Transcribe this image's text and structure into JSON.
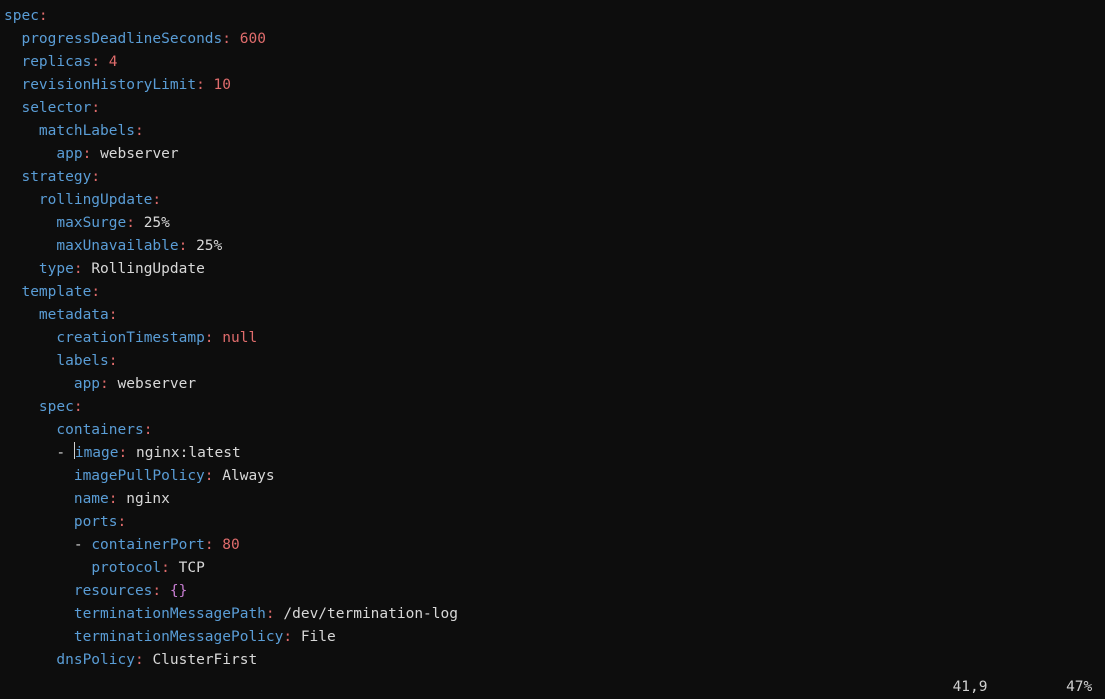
{
  "lines": [
    {
      "indent": 0,
      "key": "spec",
      "val": "",
      "type": "none"
    },
    {
      "indent": 1,
      "key": "progressDeadlineSeconds",
      "val": "600",
      "type": "num"
    },
    {
      "indent": 1,
      "key": "replicas",
      "val": "4",
      "type": "num"
    },
    {
      "indent": 1,
      "key": "revisionHistoryLimit",
      "val": "10",
      "type": "num"
    },
    {
      "indent": 1,
      "key": "selector",
      "val": "",
      "type": "none"
    },
    {
      "indent": 2,
      "key": "matchLabels",
      "val": "",
      "type": "none"
    },
    {
      "indent": 3,
      "key": "app",
      "val": "webserver",
      "type": "str"
    },
    {
      "indent": 1,
      "key": "strategy",
      "val": "",
      "type": "none"
    },
    {
      "indent": 2,
      "key": "rollingUpdate",
      "val": "",
      "type": "none"
    },
    {
      "indent": 3,
      "key": "maxSurge",
      "val": "25%",
      "type": "str"
    },
    {
      "indent": 3,
      "key": "maxUnavailable",
      "val": "25%",
      "type": "str"
    },
    {
      "indent": 2,
      "key": "type",
      "val": "RollingUpdate",
      "type": "str"
    },
    {
      "indent": 1,
      "key": "template",
      "val": "",
      "type": "none"
    },
    {
      "indent": 2,
      "key": "metadata",
      "val": "",
      "type": "none"
    },
    {
      "indent": 3,
      "key": "creationTimestamp",
      "val": "null",
      "type": "bool"
    },
    {
      "indent": 3,
      "key": "labels",
      "val": "",
      "type": "none"
    },
    {
      "indent": 4,
      "key": "app",
      "val": "webserver",
      "type": "str"
    },
    {
      "indent": 2,
      "key": "spec",
      "val": "",
      "type": "none"
    },
    {
      "indent": 3,
      "key": "containers",
      "val": "",
      "type": "none"
    },
    {
      "indent": 3,
      "dash": true,
      "cursor": true,
      "key": "image",
      "val": "nginx:latest",
      "type": "str"
    },
    {
      "indent": 4,
      "key": "imagePullPolicy",
      "val": "Always",
      "type": "str"
    },
    {
      "indent": 4,
      "key": "name",
      "val": "nginx",
      "type": "str"
    },
    {
      "indent": 4,
      "key": "ports",
      "val": "",
      "type": "none"
    },
    {
      "indent": 4,
      "dash": true,
      "key": "containerPort",
      "val": "80",
      "type": "num"
    },
    {
      "indent": 5,
      "key": "protocol",
      "val": "TCP",
      "type": "str"
    },
    {
      "indent": 4,
      "key": "resources",
      "val": "{}",
      "type": "brace"
    },
    {
      "indent": 4,
      "key": "terminationMessagePath",
      "val": "/dev/termination-log",
      "type": "str"
    },
    {
      "indent": 4,
      "key": "terminationMessagePolicy",
      "val": "File",
      "type": "str"
    },
    {
      "indent": 3,
      "key": "dnsPolicy",
      "val": "ClusterFirst",
      "type": "str"
    }
  ],
  "status": {
    "pos": "41,9",
    "pct": "47%"
  }
}
